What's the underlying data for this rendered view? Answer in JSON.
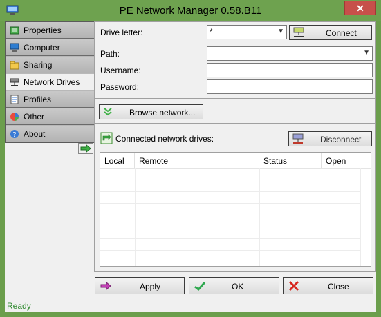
{
  "window": {
    "title": "PE Network Manager 0.58.B11",
    "close_label": "✕"
  },
  "sidebar": {
    "items": [
      {
        "label": "Properties",
        "icon": "properties-icon"
      },
      {
        "label": "Computer",
        "icon": "computer-icon"
      },
      {
        "label": "Sharing",
        "icon": "sharing-icon"
      },
      {
        "label": "Network Drives",
        "icon": "network-drive-icon",
        "active": true
      },
      {
        "label": "Profiles",
        "icon": "profiles-icon"
      },
      {
        "label": "Other",
        "icon": "other-icon"
      },
      {
        "label": "About",
        "icon": "about-icon"
      }
    ]
  },
  "form": {
    "drive_letter_label": "Drive letter:",
    "drive_letter_value": "*",
    "connect_label": "Connect",
    "path_label": "Path:",
    "path_value": "",
    "username_label": "Username:",
    "username_value": "",
    "password_label": "Password:",
    "password_value": ""
  },
  "browse": {
    "label": "Browse network..."
  },
  "connected": {
    "label": "Connected network drives:",
    "disconnect_label": "Disconnect",
    "columns": [
      "Local",
      "Remote",
      "Status",
      "Open"
    ]
  },
  "buttons": {
    "apply": "Apply",
    "ok": "OK",
    "close": "Close"
  },
  "status": {
    "text": "Ready"
  },
  "colors": {
    "window_frame": "#6b9e4c",
    "status_text": "#2f8a2f"
  }
}
